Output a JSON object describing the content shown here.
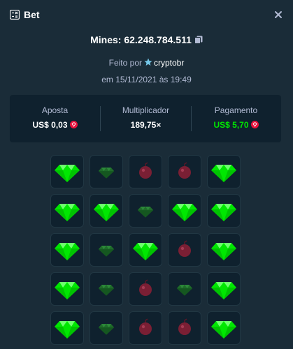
{
  "header": {
    "title": "Bet",
    "icon": "bet-slip-icon",
    "close_icon": "close-icon"
  },
  "details": {
    "mines_label": "Mines: 62.248.784.511",
    "made_by_prefix": "Feito por",
    "username": "cryptobr",
    "date": "em 15/11/2021 às 19:49"
  },
  "stats": {
    "bet_label": "Aposta",
    "bet_value": "US$ 0,03",
    "multiplier_label": "Multiplicador",
    "multiplier_value": "189,75×",
    "payout_label": "Pagamento",
    "payout_value": "US$ 5,70",
    "currency_icon": "ruby-coin-icon"
  },
  "colors": {
    "background": "#1a2c38",
    "panel": "#0f212e",
    "gem_revealed": "#00e701",
    "gem_hidden": "#1f6b2a",
    "mine_hidden": "#7a1f34",
    "muted_text": "#b1bad3"
  },
  "board": {
    "rows": 5,
    "cols": 5,
    "tiles": [
      [
        "gem",
        "gem-dim",
        "mine-dim",
        "mine-dim",
        "gem"
      ],
      [
        "gem",
        "gem",
        "gem-dim",
        "gem",
        "gem"
      ],
      [
        "gem",
        "gem-dim",
        "gem",
        "mine-dim",
        "gem"
      ],
      [
        "gem",
        "gem-dim",
        "mine-dim",
        "gem-dim",
        "gem"
      ],
      [
        "gem",
        "gem-dim",
        "mine-dim",
        "mine-dim",
        "gem"
      ]
    ]
  }
}
